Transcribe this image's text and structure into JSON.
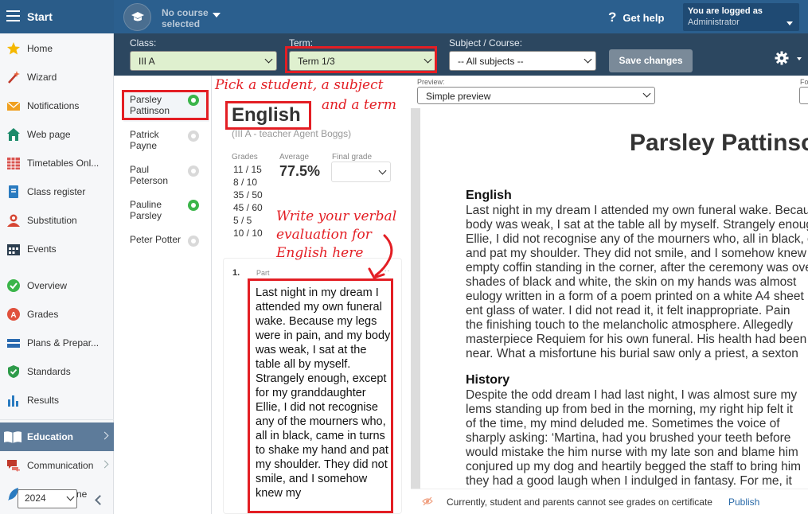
{
  "topbar": {
    "start_label": "Start",
    "course_text": "No course selected",
    "help_label": "Get help",
    "logged_label": "You are logged as",
    "logged_user": "Administrator"
  },
  "sidebar": {
    "items": [
      {
        "label": "Home",
        "icon": "star-icon"
      },
      {
        "label": "Wizard",
        "icon": "wand-icon"
      },
      {
        "label": "Notifications",
        "icon": "envelope-icon"
      },
      {
        "label": "Web page",
        "icon": "house-icon"
      },
      {
        "label": "Timetables Onl...",
        "icon": "timetable-grid-icon"
      },
      {
        "label": "Class register",
        "icon": "register-book-icon"
      },
      {
        "label": "Substitution",
        "icon": "person-swap-icon"
      },
      {
        "label": "Events",
        "icon": "calendar-icon"
      },
      {
        "label": "Overview",
        "icon": "check-circle-icon"
      },
      {
        "label": "Grades",
        "icon": "grades-icon"
      },
      {
        "label": "Plans & Prepar...",
        "icon": "plans-icon"
      },
      {
        "label": "Standards",
        "icon": "shield-check-icon"
      },
      {
        "label": "Results",
        "icon": "bar-chart-icon"
      },
      {
        "label": "Education",
        "icon": "open-book-icon"
      },
      {
        "label": "Communication",
        "icon": "chat-icon"
      },
      {
        "label": "ne",
        "icon": "feather-icon"
      }
    ],
    "year": "2024"
  },
  "filters": {
    "class_label": "Class:",
    "class_value": "III A",
    "term_label": "Term:",
    "term_value": "Term 1/3",
    "subject_label": "Subject / Course:",
    "subject_value": "-- All subjects --",
    "save_label": "Save changes"
  },
  "students": [
    {
      "name": "Parsley Pattinson",
      "done": true
    },
    {
      "name": "Patrick Payne",
      "done": false
    },
    {
      "name": "Paul Peterson",
      "done": false
    },
    {
      "name": "Pauline Parsley",
      "done": true
    },
    {
      "name": "Peter Potter",
      "done": false
    }
  ],
  "subject": {
    "title": "English",
    "subtitle": "(III A - teacher Agent Boggs)",
    "grades_label": "Grades",
    "grades": [
      "11 / 15",
      "8 / 10",
      "35 / 50",
      "45 / 60",
      "5 / 5",
      "10 / 10"
    ],
    "average_label": "Average",
    "average": "77.5%",
    "final_label": "Final grade",
    "part_number": "1.",
    "part_label": "Part",
    "part_menu": "...",
    "evaluation": "Last night in my dream I attended my own funeral wake. Because my legs were in pain, and my body was weak, I sat at the table all by myself. Strangely enough, except for my granddaughter Ellie, I did not recognise any of the mourners who, all in black, came in turns to shake my hand and pat my shoulder. They did not smile, and I somehow knew my"
  },
  "preview": {
    "label": "Preview:",
    "select_value": "Simple preview",
    "font_label": "Fo",
    "student_name": "Parsley Pattinson",
    "sections": [
      {
        "title": "English",
        "text": "Last night in my dream I attended my own funeral wake. Because my legs were in pain, and my\nbody was weak, I sat at the table all by myself. Strangely enough, except for my granddaughter\nEllie, I did not recognise any of the mourners who, all in black, came in turns to shake my hand\nand pat my shoulder. They did not smile, and I somehow knew my\nempty coffin standing in the corner, after the ceremony was over\nshades of black and white, the skin on my hands was almost\neulogy written in a form of a poem printed on a white A4 sheet\nent glass of water. I did not read it, it felt inappropriate. Pain\nthe finishing touch to the melancholic atmosphere. Allegedly\nmasterpiece Requiem for his own funeral. His health had been\nnear. What a misfortune his burial saw only a priest, a sexton"
      },
      {
        "title": "History",
        "text": "Despite the odd dream I had last night, I was almost sure my\nlems standing up from bed in the morning, my right hip felt it\nof the time, my mind deluded me. Sometimes the voice of\nsharply asking: ‘Martina, had you brushed your teeth before\nwould mistake the him nurse with my late son and blame him\nconjured up my dog and heartily begged the staff to bring him\nthey had a good laugh when I indulged in fantasy. For me, it\nremember"
      }
    ],
    "publish_message": "Currently, student and parents cannot see grades on certificate",
    "publish_label": "Publish"
  },
  "annotations": {
    "pick_line1": "Pick a student, a subject",
    "pick_line2": "and a term",
    "write_line1": "Write your verbal",
    "write_line2": "evaluation for",
    "write_line3": "English here"
  },
  "colors": {
    "topbar": "#2b5f8e",
    "filterbar": "#2c4760",
    "annotation_red": "#e31e24",
    "status_green": "#3bb54a"
  }
}
